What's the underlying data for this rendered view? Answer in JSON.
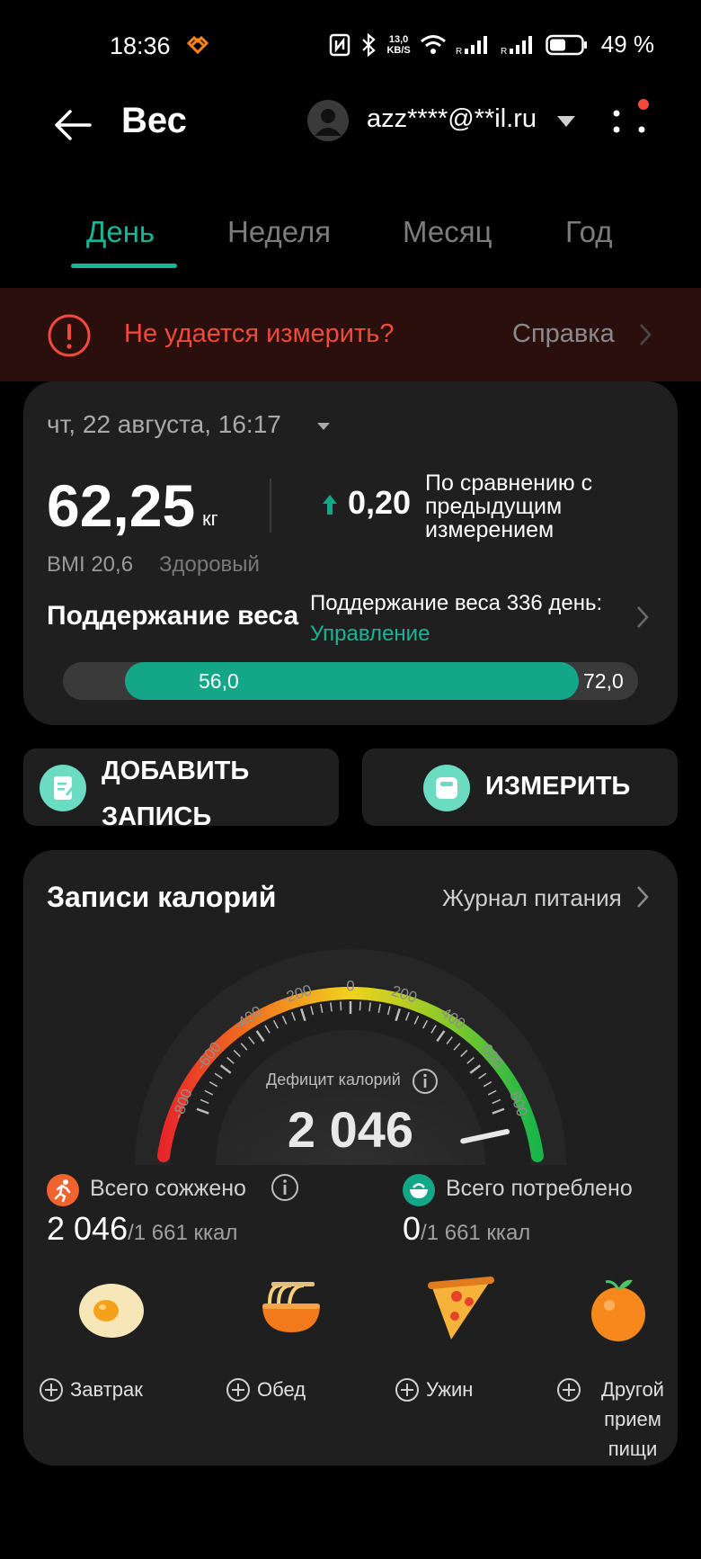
{
  "status_bar": {
    "time": "18:36",
    "net_speed_value": "13,0",
    "net_speed_unit": "KB/S",
    "battery": "49 %"
  },
  "header": {
    "title": "Вес",
    "account": "azz****@**il.ru"
  },
  "tabs": [
    {
      "label": "День",
      "active": true
    },
    {
      "label": "Неделя",
      "active": false
    },
    {
      "label": "Месяц",
      "active": false
    },
    {
      "label": "Год",
      "active": false
    }
  ],
  "banner": {
    "text": "Не удается измерить?",
    "help": "Справка"
  },
  "weight_card": {
    "date": "чт, 22 августа, 16:17",
    "weight": "62,25",
    "unit": "кг",
    "delta": "0,20",
    "compare_text": "По сравнению с предыдущим измерением",
    "bmi": "BMI 20,6",
    "bmi_status": "Здоровый",
    "goal_title": "Поддержание веса",
    "goal_days_text": "Поддержание веса 336 день:",
    "goal_link": "Управление",
    "range_min": "56,0",
    "range_max": "72,0"
  },
  "actions": {
    "add_label": "ДОБАВИТЬ ЗАПИСЬ",
    "measure_label": "ИЗМЕРИТЬ"
  },
  "calories": {
    "title": "Записи калорий",
    "journal": "Журнал питания",
    "gauge_ticks": [
      "-800",
      "-600",
      "-400",
      "-200",
      "0",
      "200",
      "400",
      "600",
      "800"
    ],
    "gauge_needle_value": 800,
    "deficit_label": "Дефицит калорий",
    "deficit_value": "2 046",
    "burned_label": "Всего сожжено",
    "burned_value": "2 046",
    "burned_of": "/1 661 ккал",
    "consumed_label": "Всего потреблено",
    "consumed_value": "0",
    "consumed_of": "/1 661 ккал",
    "meals": [
      {
        "label": "Завтрак",
        "icon": "egg-icon"
      },
      {
        "label": "Обед",
        "icon": "noodle-bowl-icon"
      },
      {
        "label": "Ужин",
        "icon": "pizza-icon"
      },
      {
        "label": "Другой прием пищи",
        "icon": "orange-icon"
      }
    ]
  },
  "colors": {
    "accent": "#19b596",
    "warning": "#ef4a3c",
    "card_bg": "#1f1f1f"
  }
}
